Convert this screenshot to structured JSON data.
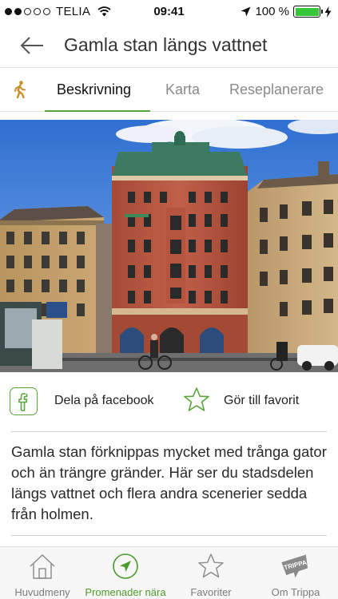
{
  "status_bar": {
    "carrier": "TELIA",
    "time": "09:41",
    "battery_percent": "100 %",
    "signal_bars_filled": 2,
    "signal_bars_total": 5,
    "battery_level": 1.0
  },
  "header": {
    "title": "Gamla stan längs vattnet"
  },
  "tabs": [
    {
      "label": "Beskrivning",
      "active": true
    },
    {
      "label": "Karta",
      "active": false
    },
    {
      "label": "Reseplanerare",
      "active": false
    }
  ],
  "actions": {
    "share_label": "Dela på facebook",
    "favorite_label": "Gör till favorit"
  },
  "description": "Gamla stan förknippas mycket med trånga gator och än trängre gränder. Här ser du stadsdelen längs vattnet och flera andra scenerier sedda från holmen.",
  "bottom_nav": [
    {
      "label": "Huvudmeny",
      "icon": "home-icon",
      "active": false
    },
    {
      "label": "Promenader nära",
      "icon": "location-arrow-icon",
      "active": true
    },
    {
      "label": "Favoriter",
      "icon": "star-icon",
      "active": false
    },
    {
      "label": "Om Trippa",
      "icon": "trippa-logo-icon",
      "active": false,
      "logo_text": "TRIPPA"
    }
  ],
  "colors": {
    "accent": "#5aa63a",
    "battery": "#37c837",
    "active_nav": "#4d9a2c"
  }
}
